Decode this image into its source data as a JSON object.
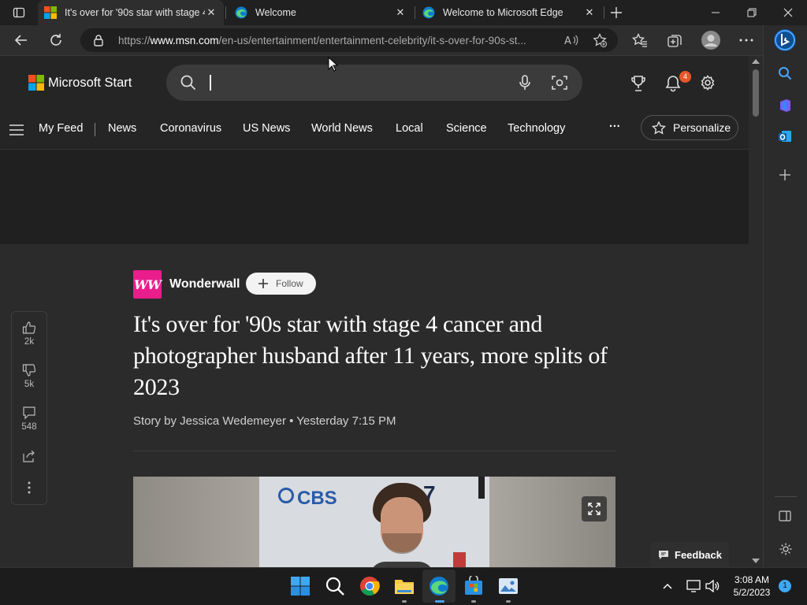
{
  "browser": {
    "tabs": [
      {
        "title": "It's over for '90s star with stage 4",
        "active": true
      },
      {
        "title": "Welcome",
        "active": false
      },
      {
        "title": "Welcome to Microsoft Edge",
        "active": false
      }
    ],
    "url_prefix": "https://",
    "url_host": "www.msn.com",
    "url_path": "/en-us/entertainment/entertainment-celebrity/it-s-over-for-90s-st..."
  },
  "msn": {
    "brand": "Microsoft Start",
    "notification_count": "4",
    "nav": [
      "My Feed",
      "News",
      "Coronavirus",
      "US News",
      "World News",
      "Local",
      "Science",
      "Technology"
    ],
    "more_label": "···",
    "personalize_label": "Personalize"
  },
  "article": {
    "source_logo": "WW",
    "source_name": "Wonderwall",
    "follow_label": "Follow",
    "headline": "It's over for '90s star with stage 4 cancer and photographer husband after 11 years, more splits of 2023",
    "byline": "Story by Jessica Wedemeyer • Yesterday 7:15 PM",
    "hero_text": [
      "CBS",
      "S",
      "7"
    ],
    "likes": "2k",
    "dislikes": "5k",
    "comments": "548"
  },
  "feedback_label": "Feedback",
  "taskbar": {
    "time": "3:08 AM",
    "date": "5/2/2023",
    "notification_badge": "1"
  },
  "colors": {
    "accent_pink": "#e91e8c",
    "notification_orange": "#e8562a",
    "edge_blue": "#0078d4"
  }
}
